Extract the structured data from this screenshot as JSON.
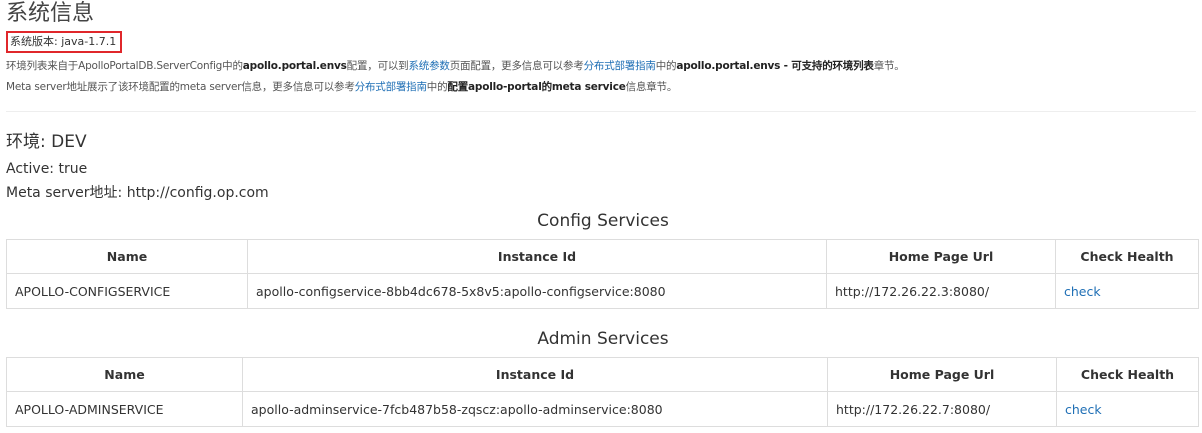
{
  "page": {
    "title": "系统信息",
    "version": "系统版本: java-1.7.1",
    "info1": {
      "t1": "环境列表来自于ApolloPortalDB.ServerConfig中的",
      "b1": "apollo.portal.envs",
      "t2": "配置，可以到",
      "link1": "系统参数",
      "t3": "页面配置，更多信息可以参考",
      "link2": "分布式部署指南",
      "t4": "中的",
      "b2": "apollo.portal.envs - 可支持的环境列表",
      "t5": "章节。"
    },
    "info2": {
      "t1": "Meta server地址展示了该环境配置的meta server信息，更多信息可以参考",
      "link1": "分布式部署指南",
      "t2": "中的",
      "b1": "配置apollo-portal的meta service",
      "t3": "信息章节。"
    }
  },
  "env": {
    "title": "环境: DEV",
    "active": "Active: true",
    "meta": "Meta server地址: http://config.op.com"
  },
  "config_services": {
    "title": "Config Services",
    "headers": [
      "Name",
      "Instance Id",
      "Home Page Url",
      "Check Health"
    ],
    "rows": [
      {
        "name": "APOLLO-CONFIGSERVICE",
        "instance_id": "apollo-configservice-8bb4dc678-5x8v5:apollo-configservice:8080",
        "url": "http://172.26.22.3:8080/",
        "check": "check"
      }
    ]
  },
  "admin_services": {
    "title": "Admin Services",
    "headers": [
      "Name",
      "Instance Id",
      "Home Page Url",
      "Check Health"
    ],
    "rows": [
      {
        "name": "APOLLO-ADMINSERVICE",
        "instance_id": "apollo-adminservice-7fcb487b58-zqscz:apollo-adminservice:8080",
        "url": "http://172.26.22.7:8080/",
        "check": "check"
      }
    ]
  },
  "colors": {
    "link": "#1f6fb5",
    "highlight_border": "#e0272b",
    "table_border": "#dddddd"
  }
}
